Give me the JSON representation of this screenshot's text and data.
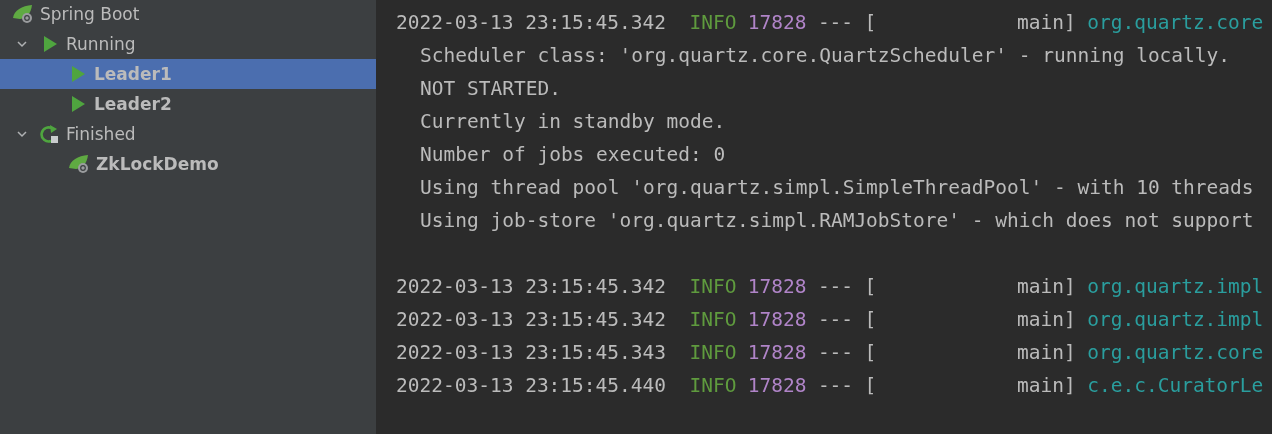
{
  "run_tree": [
    {
      "label": "Spring Boot",
      "kind": "spring",
      "selected": false,
      "children": [
        {
          "label": "Running",
          "kind": "run",
          "selected": false,
          "expanded": true,
          "children": [
            {
              "label": "Leader1",
              "kind": "run",
              "selected": true
            },
            {
              "label": "Leader2",
              "kind": "run",
              "selected": false
            }
          ]
        },
        {
          "label": "Finished",
          "kind": "finished",
          "selected": false,
          "expanded": true,
          "children": [
            {
              "label": "ZkLockDemo",
              "kind": "spring",
              "selected": false
            }
          ]
        }
      ]
    }
  ],
  "console": [
    {
      "kind": "log",
      "time": "2022-03-13 23:15:45.342",
      "level": "INFO",
      "pid": "17828",
      "sep": "---",
      "thread": "[            main]",
      "logger": "org.quartz.core"
    },
    {
      "kind": "message",
      "text": "Scheduler class: 'org.quartz.core.QuartzScheduler' - running locally."
    },
    {
      "kind": "message",
      "text": "NOT STARTED."
    },
    {
      "kind": "message",
      "text": "Currently in standby mode."
    },
    {
      "kind": "message",
      "text": "Number of jobs executed: 0"
    },
    {
      "kind": "message",
      "text": "Using thread pool 'org.quartz.simpl.SimpleThreadPool' - with 10 threads"
    },
    {
      "kind": "message",
      "text": "Using job-store 'org.quartz.simpl.RAMJobStore' - which does not support"
    },
    {
      "kind": "blank"
    },
    {
      "kind": "log",
      "time": "2022-03-13 23:15:45.342",
      "level": "INFO",
      "pid": "17828",
      "sep": "---",
      "thread": "[            main]",
      "logger": "org.quartz.impl"
    },
    {
      "kind": "log",
      "time": "2022-03-13 23:15:45.342",
      "level": "INFO",
      "pid": "17828",
      "sep": "---",
      "thread": "[            main]",
      "logger": "org.quartz.impl"
    },
    {
      "kind": "log",
      "time": "2022-03-13 23:15:45.343",
      "level": "INFO",
      "pid": "17828",
      "sep": "---",
      "thread": "[            main]",
      "logger": "org.quartz.core"
    },
    {
      "kind": "log",
      "time": "2022-03-13 23:15:45.440",
      "level": "INFO",
      "pid": "17828",
      "sep": "---",
      "thread": "[            main]",
      "logger": "c.e.c.CuratorLe"
    }
  ]
}
